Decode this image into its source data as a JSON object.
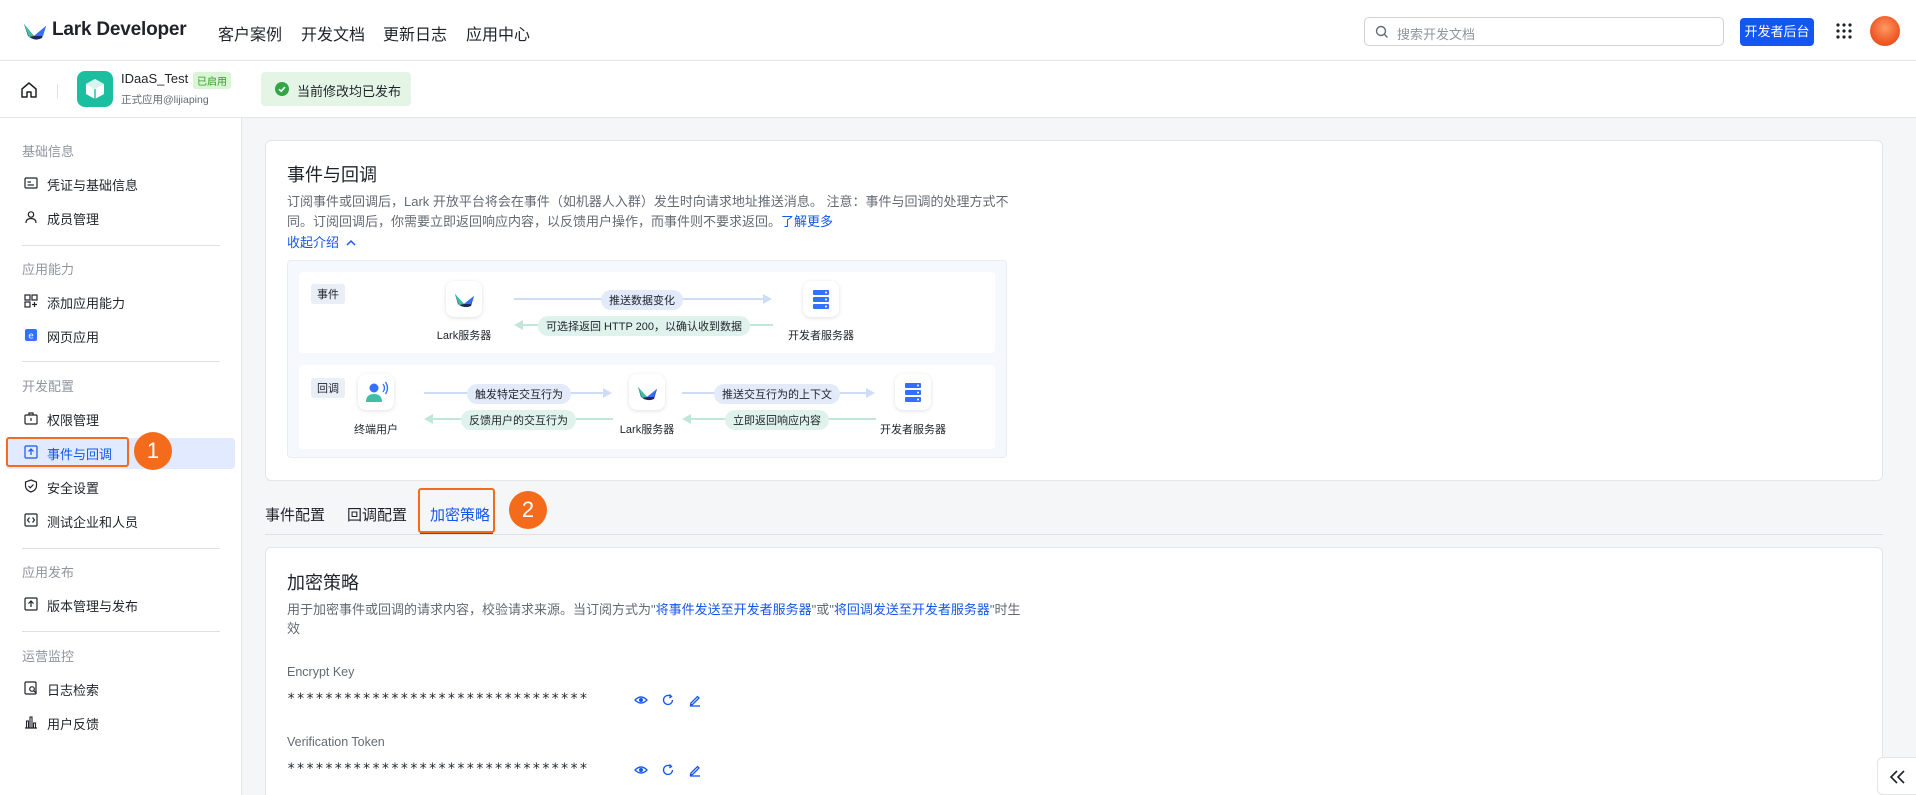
{
  "topnav": {
    "logo_text": "Lark Developer",
    "links": [
      "客户案例",
      "开发文档",
      "更新日志",
      "应用中心"
    ],
    "search_placeholder": "搜索开发文档",
    "dev_console_button": "开发者后台"
  },
  "app": {
    "name": "IDaaS_Test",
    "status_badge": "已启用",
    "subtitle": "正式应用@lijiaping",
    "publish_status": "当前修改均已发布"
  },
  "sidebar": {
    "sections": [
      {
        "title": "基础信息",
        "items": [
          "凭证与基础信息",
          "成员管理"
        ]
      },
      {
        "title": "应用能力",
        "items": [
          "添加应用能力",
          "网页应用"
        ]
      },
      {
        "title": "开发配置",
        "items": [
          "权限管理",
          "事件与回调",
          "安全设置",
          "测试企业和人员"
        ]
      },
      {
        "title": "应用发布",
        "items": [
          "版本管理与发布"
        ]
      },
      {
        "title": "运营监控",
        "items": [
          "日志检索",
          "用户反馈"
        ]
      }
    ],
    "active_item": "事件与回调"
  },
  "callouts": [
    "1",
    "2"
  ],
  "intro": {
    "title": "事件与回调",
    "desc_line1": "订阅事件或回调后，Lark 开放平台将会在事件（如机器人入群）发生时向请求地址推送消息。 注意：事件与回调的处理方式不",
    "desc_line2_pre": "同。订阅回调后，你需要立即返回响应内容，以反馈用户操作，而事件则不要求返回。",
    "learn_more": "了解更多",
    "collapse": "收起介绍",
    "diagram": {
      "event_tag": "事件",
      "callback_tag": "回调",
      "lark_server": "Lark服务器",
      "dev_server": "开发者服务器",
      "end_user": "终端用户",
      "push_change": "推送数据变化",
      "return_200": "可选择返回 HTTP 200，以确认收到数据",
      "trigger": "触发特定交互行为",
      "feedback": "反馈用户的交互行为",
      "push_context": "推送交互行为的上下文",
      "return_immediately": "立即返回响应内容"
    }
  },
  "tabs": [
    "事件配置",
    "回调配置",
    "加密策略"
  ],
  "active_tab": "加密策略",
  "encryption": {
    "title": "加密策略",
    "desc_pre": "用于加密事件或回调的请求内容，校验请求来源。当订阅方式为\"",
    "desc_link1": "将事件发送至开发者服务器",
    "desc_mid": "\"或\"",
    "desc_link2": "将回调发送至开发者服务器",
    "desc_post": "\"时生",
    "desc_line2": "效",
    "encrypt_key_label": "Encrypt Key",
    "encrypt_key_value": "********************************",
    "verification_token_label": "Verification Token",
    "verification_token_value": "********************************"
  }
}
